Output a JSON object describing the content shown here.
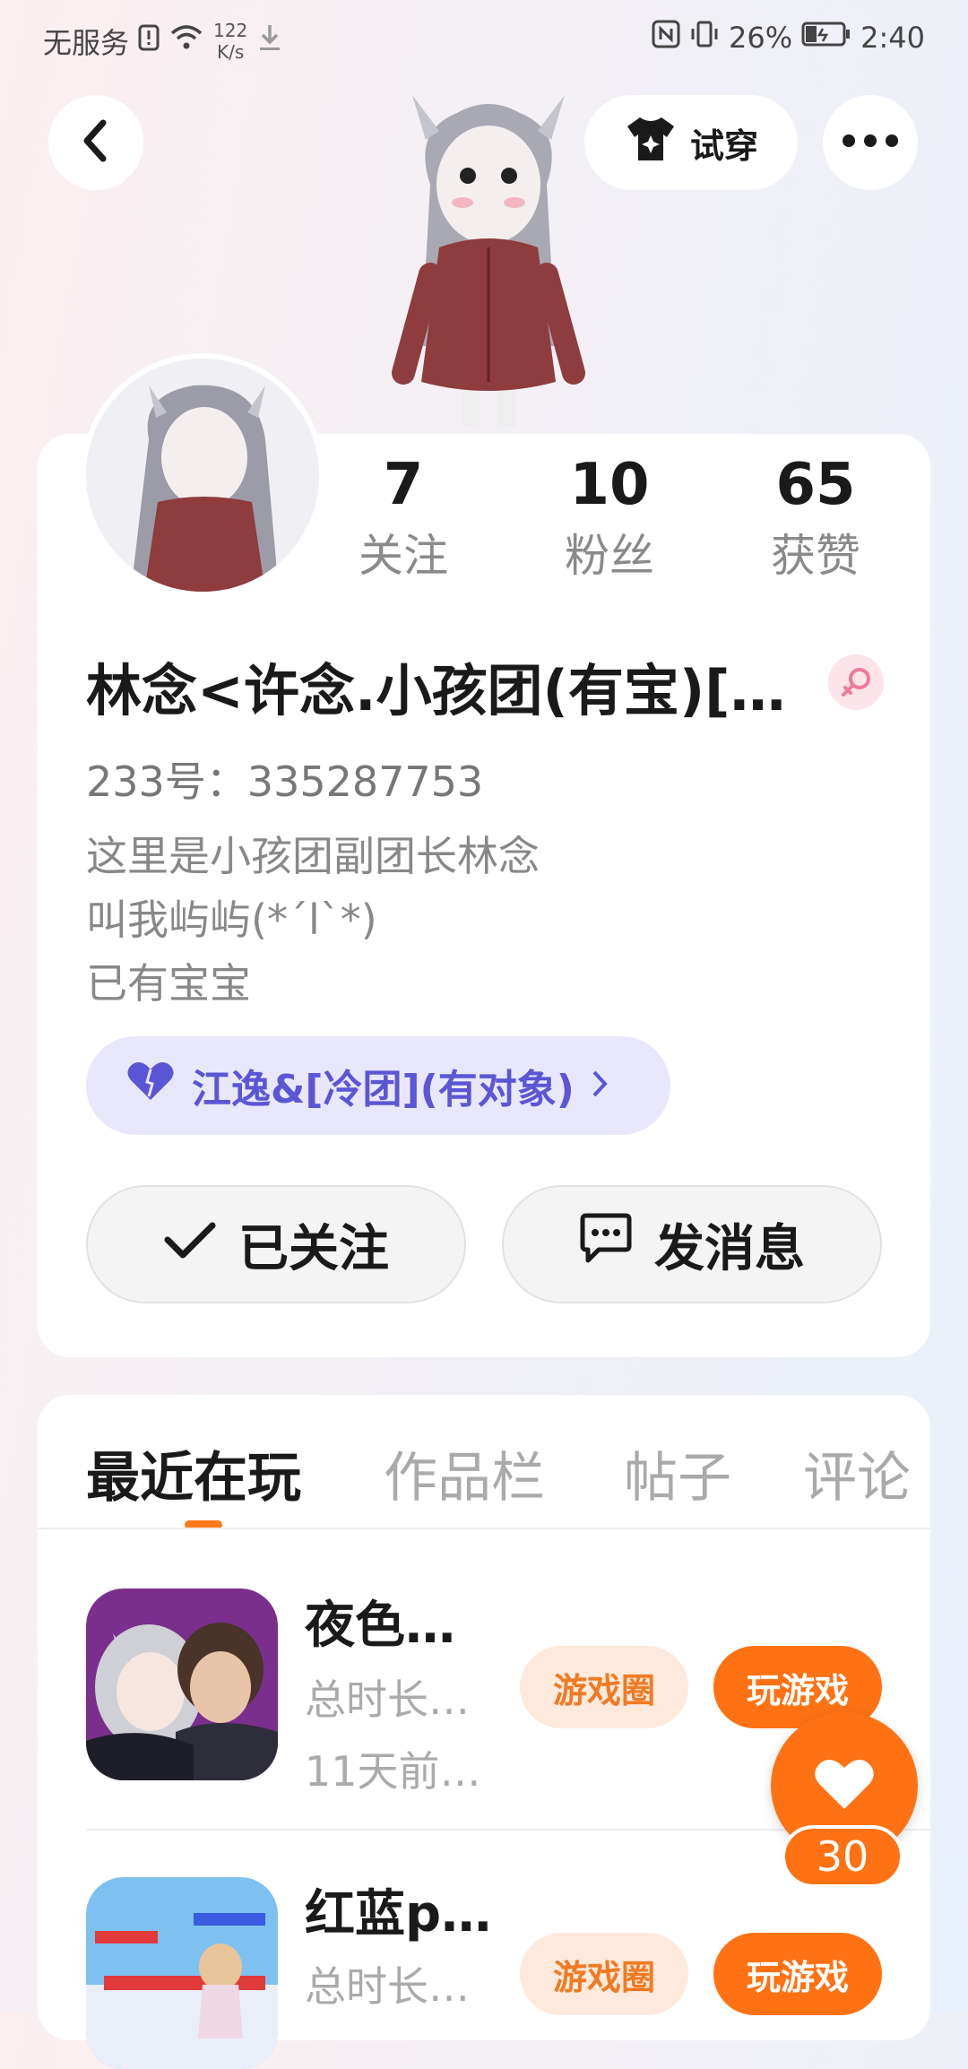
{
  "status_bar": {
    "carrier": "无服务",
    "net_speed_value": "122",
    "net_speed_unit": "K/s",
    "battery": "26%",
    "time": "2:40"
  },
  "header": {
    "try_on_label": "试穿"
  },
  "profile": {
    "stats": [
      {
        "value": "7",
        "label": "关注"
      },
      {
        "value": "10",
        "label": "粉丝"
      },
      {
        "value": "65",
        "label": "获赞"
      }
    ],
    "name": "林念<许念.小孩团(有宝)[…",
    "uid": "233号：335287753",
    "bio": [
      "这里是小孩团副团长林念",
      "叫我屿屿(*´l`*)",
      "已有宝宝"
    ],
    "couple_label": "江逸&[冷团](有对象)",
    "follow_label": "已关注",
    "message_label": "发消息"
  },
  "tabs": [
    {
      "label": "最近在玩",
      "active": true
    },
    {
      "label": "作品栏",
      "active": false
    },
    {
      "label": "帖子",
      "active": false
    },
    {
      "label": "评论",
      "active": false
    }
  ],
  "games": [
    {
      "title": "夜色…",
      "playtime": "总时长…",
      "last_played": "11天前…",
      "circle_label": "游戏圈",
      "play_label": "玩游戏"
    },
    {
      "title": "红蓝p…",
      "playtime": "总时长…",
      "last_played": "",
      "circle_label": "游戏圈",
      "play_label": "玩游戏"
    }
  ],
  "like": {
    "count": "30"
  },
  "colors": {
    "accent_orange": "#ff7214",
    "couple_purple": "#5b56d6",
    "couple_bg": "#e9e7fb"
  }
}
